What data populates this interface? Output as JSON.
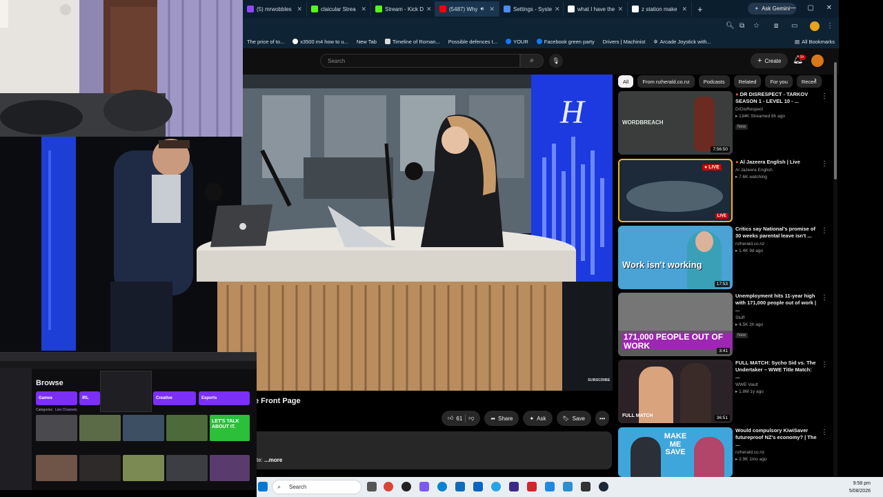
{
  "browser": {
    "tabs": [
      {
        "label": "(5) mrwobbles",
        "color": "#9147ff"
      },
      {
        "label": "claicular Strea",
        "color": "#53fc18"
      },
      {
        "label": "Stream - Kick D",
        "color": "#53fc18"
      },
      {
        "label": "(5487) Why",
        "color": "#ff0000"
      },
      {
        "label": "Settings - Syste",
        "color": "#4c8bf5"
      },
      {
        "label": "what I have the",
        "color": "#ffffff"
      },
      {
        "label": "z station make",
        "color": "#ffffff"
      }
    ],
    "new_tab": "+",
    "ask_gemini": "Ask Gemini",
    "window_controls": {
      "min": "—",
      "max": "▢",
      "close": "✕"
    },
    "bookmarks": [
      {
        "label": "The price of to...",
        "color": "#888888"
      },
      {
        "label": "x3500 m4 how to u...",
        "color": "#ffffff"
      },
      {
        "label": "New Tab",
        "color": "#4c8bf5"
      },
      {
        "label": "Timeline of Roman...",
        "color": "#dddddd"
      },
      {
        "label": "Possible defences t...",
        "color": "#ffffff"
      },
      {
        "label": "YOUR",
        "color": "#1877f2"
      },
      {
        "label": "Facebook green party",
        "color": "#1877f2"
      },
      {
        "label": "Drivers | Machinist",
        "color": "#444444"
      },
      {
        "label": "Arcade Joystick with...",
        "color": "#aaaaaa"
      }
    ],
    "all_bookmarks": "All Bookmarks"
  },
  "youtube": {
    "search_placeholder": "Search",
    "create_label": "Create",
    "notif_count": "9+",
    "video": {
      "title_fragment": "e Front Page",
      "likes": "61",
      "share": "Share",
      "ask": "Ask",
      "save": "Save",
      "more_label": "...more",
      "desc_fragment": "te:",
      "subscribe_text": "SUBSCRIBE"
    },
    "chips": [
      {
        "label": "All",
        "active": true
      },
      {
        "label": "From nzherald.co.nz",
        "active": false
      },
      {
        "label": "Podcasts",
        "active": false
      },
      {
        "label": "Related",
        "active": false
      },
      {
        "label": "For you",
        "active": false
      },
      {
        "label": "Recen",
        "active": false
      }
    ],
    "recommendations": [
      {
        "title": "DR DISRESPECT - TARKOV SEASON 1 - LEVEL 10 - ...",
        "channel": "DrDisRespect",
        "stats": "134K  Streamed 8h ago",
        "badge": "New",
        "duration": "7:56:50",
        "live": false,
        "thumb_color": "#3a3d3c",
        "overlay": "",
        "live_dot": true
      },
      {
        "title": "Al Jazeera English | Live",
        "channel": "Al Jazeera English",
        "stats": "7.6K watching",
        "badge": "",
        "duration": "LIVE",
        "live": true,
        "thumb_color": "#1c2a3a",
        "overlay": "",
        "live_dot": true
      },
      {
        "title": "Critics say National's promise of 30 weeks parental leave isn't ...",
        "channel": "nzherald.co.nz",
        "stats": "1.4K  9d ago",
        "badge": "",
        "duration": "17:53",
        "live": false,
        "thumb_color": "#4aa3d4",
        "overlay": "Work isn't working",
        "live_dot": false
      },
      {
        "title": "Unemployment hits 11-year high with 171,000 people out of work | ...",
        "channel": "Stuff",
        "stats": "4.5K  2h ago",
        "badge": "New",
        "duration": "3:41",
        "live": false,
        "thumb_color": "#5b5b5b",
        "overlay": "171,000 PEOPLE OUT OF WORK",
        "live_dot": false
      },
      {
        "title": "FULL MATCH: Sycho Sid vs. The Undertaker – WWE Title Match: ...",
        "channel": "WWE Vault",
        "stats": "1.8M  1y ago",
        "badge": "",
        "duration": "36:51",
        "live": false,
        "thumb_color": "#2a2226",
        "overlay": "FULL MATCH",
        "live_dot": false
      },
      {
        "title": "Would compulsory KiwiSaver futureproof NZ's economy? | The ...",
        "channel": "nzherald.co.nz",
        "stats": "2.9K  1mo ago",
        "badge": "",
        "duration": "",
        "live": false,
        "thumb_color": "#3fa6dc",
        "overlay": "MAKE ME SAVE",
        "live_dot": false
      }
    ]
  },
  "twitch": {
    "browse": "Browse",
    "categories": [
      {
        "label": "Games",
        "color": "#7b2ff7"
      },
      {
        "label": "IRL",
        "color": "#7b2ff7"
      },
      {
        "label": "Creative",
        "color": "#7b2ff7"
      },
      {
        "label": "Esports",
        "color": "#7b2ff7"
      }
    ],
    "tabs": [
      "Categories",
      "Live Channels"
    ],
    "promo": "LET'S TALK ABOUT IT."
  },
  "taskbar": {
    "search": "Search",
    "time": "9:58 pm",
    "date": "5/08/2026"
  }
}
